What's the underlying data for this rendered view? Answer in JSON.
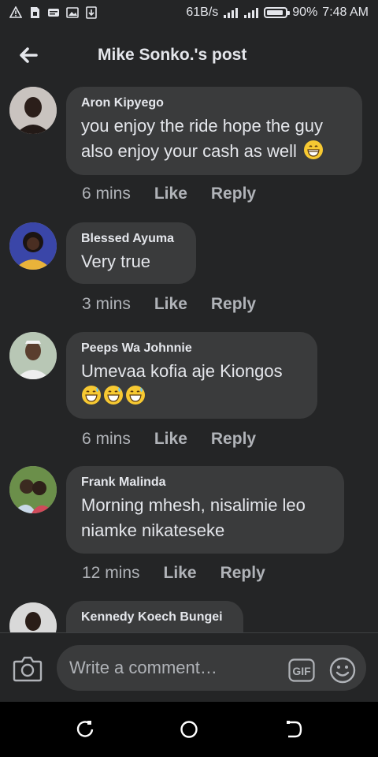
{
  "status_bar": {
    "network_speed": "61B/s",
    "battery_percent": "90%",
    "battery_level": 0.9,
    "time": "7:48 AM",
    "icons": [
      "alert-triangle-icon",
      "sim-card-icon",
      "message-icon",
      "image-icon",
      "download-icon",
      "wifi-signal-icon",
      "cell-signal-icon",
      "battery-icon"
    ]
  },
  "header": {
    "title": "Mike Sonko.'s post",
    "back_icon": "arrow-left-icon"
  },
  "comments": [
    {
      "author": "Aron Kipyego",
      "lines": [
        "you enjoy the ride hope the guy",
        "also enjoy your cash as well"
      ],
      "emojis": [
        "grinning-face"
      ],
      "time": "6 mins",
      "like": "Like",
      "reply": "Reply",
      "avatar_colors": [
        "#c9c3bf",
        "#2b1e1a"
      ]
    },
    {
      "author": "Blessed Ayuma",
      "lines": [
        "Very true"
      ],
      "emojis": [],
      "time": "3 mins",
      "like": "Like",
      "reply": "Reply",
      "avatar_colors": [
        "#3a46a8",
        "#1b1412"
      ]
    },
    {
      "author": "Peeps Wa Johnnie",
      "lines": [
        "Umevaa kofia aje Kiongos"
      ],
      "emojis": [
        "grinning-sweat",
        "grinning-sweat",
        "grinning-sweat"
      ],
      "time": "6 mins",
      "like": "Like",
      "reply": "Reply",
      "avatar_colors": [
        "#b8c7b5",
        "#5a3e2e"
      ]
    },
    {
      "author": "Frank Malinda",
      "lines": [
        "Morning mhesh, nisalimie leo",
        "niamke nikateseke"
      ],
      "emojis": [],
      "time": "12 mins",
      "like": "Like",
      "reply": "Reply",
      "avatar_colors": [
        "#6b8f4a",
        "#3b2a20"
      ]
    },
    {
      "author": "Kennedy Koech Bungei",
      "lines": [],
      "emojis": [],
      "avatar_colors": [
        "#d9d9d9",
        "#2a1d18"
      ]
    }
  ],
  "composer": {
    "placeholder": "Write a comment…",
    "camera_icon": "camera-icon",
    "gif_label": "GIF",
    "emoji_icon": "smiley-icon"
  },
  "nav_bar": {
    "icons": [
      "recent-apps-icon",
      "home-icon",
      "back-nav-icon"
    ]
  },
  "colors": {
    "background": "#242526",
    "bubble": "#3a3b3c",
    "text_primary": "#e4e6eb",
    "text_secondary": "#b0b3b8"
  }
}
